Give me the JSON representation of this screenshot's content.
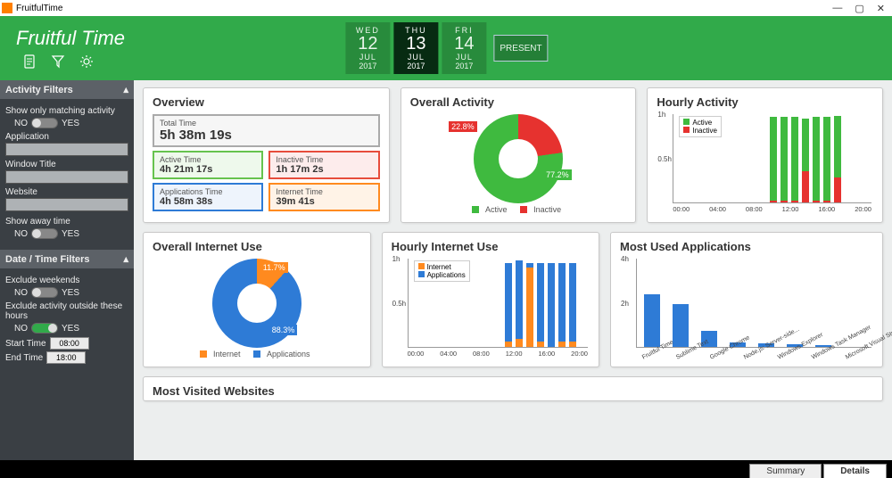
{
  "app_title": "FruitfulTime",
  "brand": "Fruitful Time",
  "window_buttons": {
    "min": "—",
    "max": "▢",
    "close": "✕"
  },
  "header_icons": {
    "doc": "doc-icon",
    "filter": "filter-icon",
    "gear": "gear-icon"
  },
  "dates": [
    {
      "dow": "WED",
      "day": "12",
      "mon": "JUL",
      "yr": "2017",
      "active": false
    },
    {
      "dow": "THU",
      "day": "13",
      "mon": "JUL",
      "yr": "2017",
      "active": true
    },
    {
      "dow": "FRI",
      "day": "14",
      "mon": "JUL",
      "yr": "2017",
      "active": false
    }
  ],
  "present_label": "PRESENT",
  "sidebar": {
    "section1": {
      "title": "Activity Filters",
      "show_matching_label": "Show only matching activity",
      "no": "NO",
      "yes": "YES",
      "application_label": "Application",
      "window_title_label": "Window Title",
      "website_label": "Website",
      "show_away_label": "Show away time"
    },
    "section2": {
      "title": "Date / Time Filters",
      "exclude_weekends": "Exclude weekends",
      "exclude_outside": "Exclude activity outside these hours",
      "start_time_label": "Start Time",
      "start_time_value": "08:00",
      "end_time_label": "End Time",
      "end_time_value": "18:00"
    }
  },
  "overview": {
    "title": "Overview",
    "total_label": "Total Time",
    "total_value": "5h 38m 19s",
    "active_label": "Active Time",
    "active_value": "4h 21m 17s",
    "inactive_label": "Inactive Time",
    "inactive_value": "1h 17m 2s",
    "apps_label": "Applications Time",
    "apps_value": "4h 58m 38s",
    "internet_label": "Internet Time",
    "internet_value": "39m 41s",
    "colors": {
      "active": "#66c34e",
      "inactive": "#e74c3c",
      "apps": "#2e7bd6",
      "internet": "#ff8a1f"
    }
  },
  "overall_activity": {
    "title": "Overall Activity",
    "legend_active": "Active",
    "legend_inactive": "Inactive"
  },
  "hourly_activity": {
    "title": "Hourly Activity",
    "legend_active": "Active",
    "legend_inactive": "Inactive"
  },
  "overall_internet": {
    "title": "Overall Internet Use",
    "legend_internet": "Internet",
    "legend_apps": "Applications"
  },
  "hourly_internet": {
    "title": "Hourly Internet Use",
    "legend_internet": "Internet",
    "legend_apps": "Applications"
  },
  "most_apps": {
    "title": "Most Used Applications"
  },
  "most_sites": {
    "title": "Most Visited Websites"
  },
  "footer_tabs": {
    "summary": "Summary",
    "details": "Details"
  },
  "chart_data": [
    {
      "id": "overall_activity",
      "type": "pie",
      "title": "Overall Activity",
      "series": [
        {
          "name": "Active",
          "value": 77.2,
          "color": "#3fba3f"
        },
        {
          "name": "Inactive",
          "value": 22.8,
          "color": "#e6322f"
        }
      ],
      "label_active": "77.2%",
      "label_inactive": "22.8%"
    },
    {
      "id": "hourly_activity",
      "type": "bar",
      "title": "Hourly Activity",
      "xlabel": "",
      "ylabel": "h",
      "ylim": [
        0,
        1
      ],
      "categories": [
        "00:00",
        "04:00",
        "08:00",
        "12:00",
        "16:00",
        "20:00"
      ],
      "series": [
        {
          "name": "Active",
          "color": "#3fba3f",
          "values_by_hour": {
            "11": 0.95,
            "12": 0.95,
            "13": 0.95,
            "14": 0.6,
            "15": 0.95,
            "16": 0.95,
            "17": 0.7
          }
        },
        {
          "name": "Inactive",
          "color": "#e6322f",
          "values_by_hour": {
            "11": 0.02,
            "12": 0.02,
            "13": 0.02,
            "14": 0.35,
            "15": 0.02,
            "16": 0.02,
            "17": 0.28
          }
        }
      ]
    },
    {
      "id": "overall_internet",
      "type": "pie",
      "title": "Overall Internet Use",
      "series": [
        {
          "name": "Internet",
          "value": 11.7,
          "color": "#ff8a1f"
        },
        {
          "name": "Applications",
          "value": 88.3,
          "color": "#2e7bd6"
        }
      ],
      "label_internet": "11.7%",
      "label_apps": "88.3%"
    },
    {
      "id": "hourly_internet",
      "type": "bar",
      "title": "Hourly Internet Use",
      "xlabel": "",
      "ylabel": "h",
      "ylim": [
        0,
        1
      ],
      "categories": [
        "00:00",
        "04:00",
        "08:00",
        "12:00",
        "16:00",
        "20:00"
      ],
      "series": [
        {
          "name": "Applications",
          "color": "#2e7bd6",
          "values_by_hour": {
            "11": 0.9,
            "12": 0.9,
            "13": 0.05,
            "14": 0.9,
            "15": 0.9,
            "16": 0.9,
            "17": 0.9
          }
        },
        {
          "name": "Internet",
          "color": "#ff8a1f",
          "values_by_hour": {
            "11": 0.05,
            "12": 0.08,
            "13": 0.9,
            "14": 0.05,
            "15": 0.0,
            "16": 0.05,
            "17": 0.05
          }
        }
      ]
    },
    {
      "id": "most_apps",
      "type": "bar",
      "title": "Most Used Applications",
      "xlabel": "",
      "ylabel": "h",
      "ylim": [
        0,
        4
      ],
      "categories": [
        "Fruitful Time",
        "Sublime Text",
        "Google Chrome",
        "Node.js: Server-side...",
        "Windows Explorer",
        "Windows Task Manager",
        "Microsoft Visual Studio..."
      ],
      "values": [
        2.4,
        1.9,
        0.7,
        0.2,
        0.15,
        0.1,
        0.05
      ],
      "color": "#2e7bd6"
    }
  ]
}
